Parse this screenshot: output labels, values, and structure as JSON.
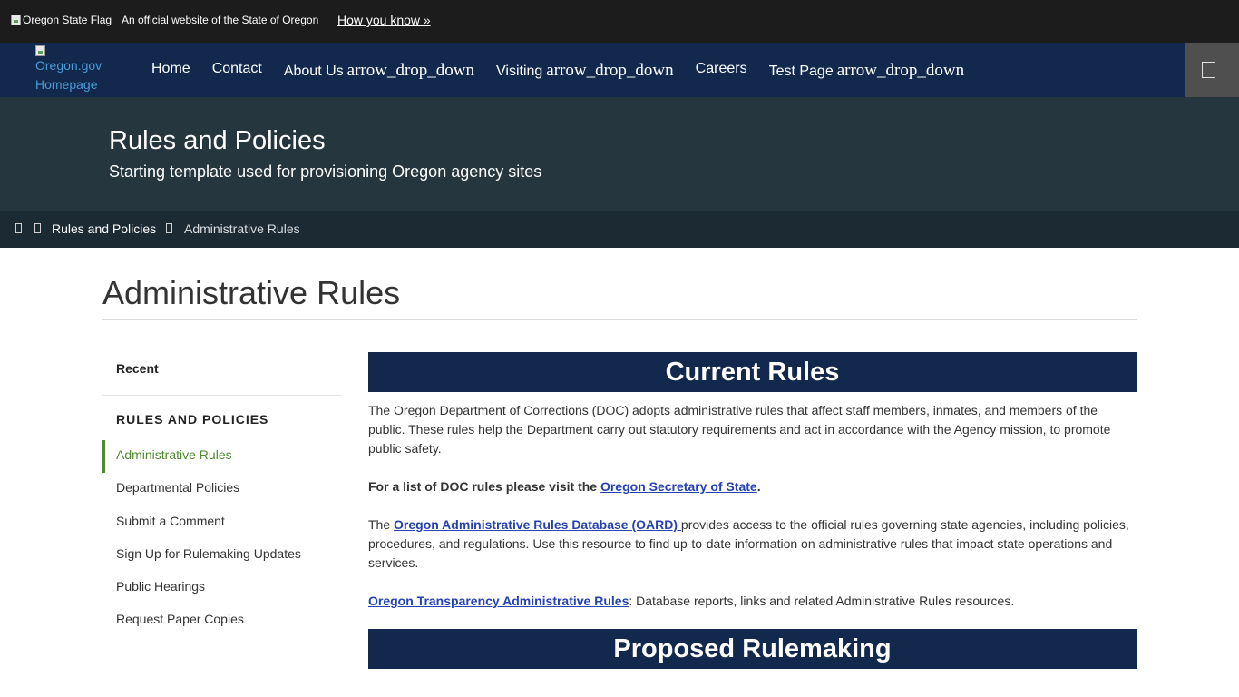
{
  "official_bar": {
    "flag_alt": "Oregon State Flag",
    "official_text": "An official website of the State of Oregon",
    "how_link": "How you know »"
  },
  "nav": {
    "logo_alt": "Oregon.gov Homepage",
    "dropdown_glyph": "arrow_drop_down",
    "items": [
      {
        "label": "Home"
      },
      {
        "label": "Contact"
      },
      {
        "label": "About Us"
      },
      {
        "label": "Visiting"
      },
      {
        "label": "Careers"
      },
      {
        "label": "Test Page"
      }
    ],
    "menu_icon": "menu-icon"
  },
  "hero": {
    "title": "Rules and Policies",
    "subtitle": "Starting template used for provisioning Oregon agency sites"
  },
  "breadcrumb": {
    "home_icon": "home-icon",
    "separator_icon": "chevron-right-icon",
    "items": [
      "Rules and Policies",
      "Administrative Rules"
    ]
  },
  "page": {
    "title": "Administrative Rules"
  },
  "sidebar": {
    "recent": "Recent",
    "heading": "RULES AND POLICIES",
    "items": [
      {
        "label": "Administrative Rules",
        "active": true
      },
      {
        "label": "Departmental Policies"
      },
      {
        "label": "Submit a Comment"
      },
      {
        "label": "Sign Up for Rulemaking Updates"
      },
      {
        "label": "Public Hearings"
      },
      {
        "label": "Request Paper Copies"
      }
    ]
  },
  "content": {
    "current_rules_heading": "Current Rules",
    "para1": "The Oregon Department of Corrections (DOC) adopts administrative rules that affect staff members, inmates, and members of the public. These rules help the Department carry out statutory requirements and act in accordance with the Agency mission, to promote public safety.",
    "para2_prefix": "For a list of DOC rules please visit the ",
    "para2_link": "Oregon Secretary of State",
    "para2_suffix": ".",
    "para3_prefix": "The ",
    "para3_link": "Oregon Administrative Rules Database (OARD) ",
    "para3_suffix": "provides access to the official rules governing state agencies, including policies, procedures, and regulations. Use this resource to find up-to-date information on administrative rules that impact state operations and services.",
    "para4_link": "Oregon Transparency Administrative Rules",
    "para4_suffix": ": Database reports, links and related Administrative Rules resources.",
    "proposed_heading": "Proposed Rulemaking"
  },
  "colors": {
    "nav_bg": "#12284c",
    "hero_bg": "#26363f",
    "breadcrumb_bg": "#1c2a33",
    "official_bg": "#1c1c1c",
    "active_green": "#4f8a2e",
    "link_blue": "#2541b2"
  }
}
